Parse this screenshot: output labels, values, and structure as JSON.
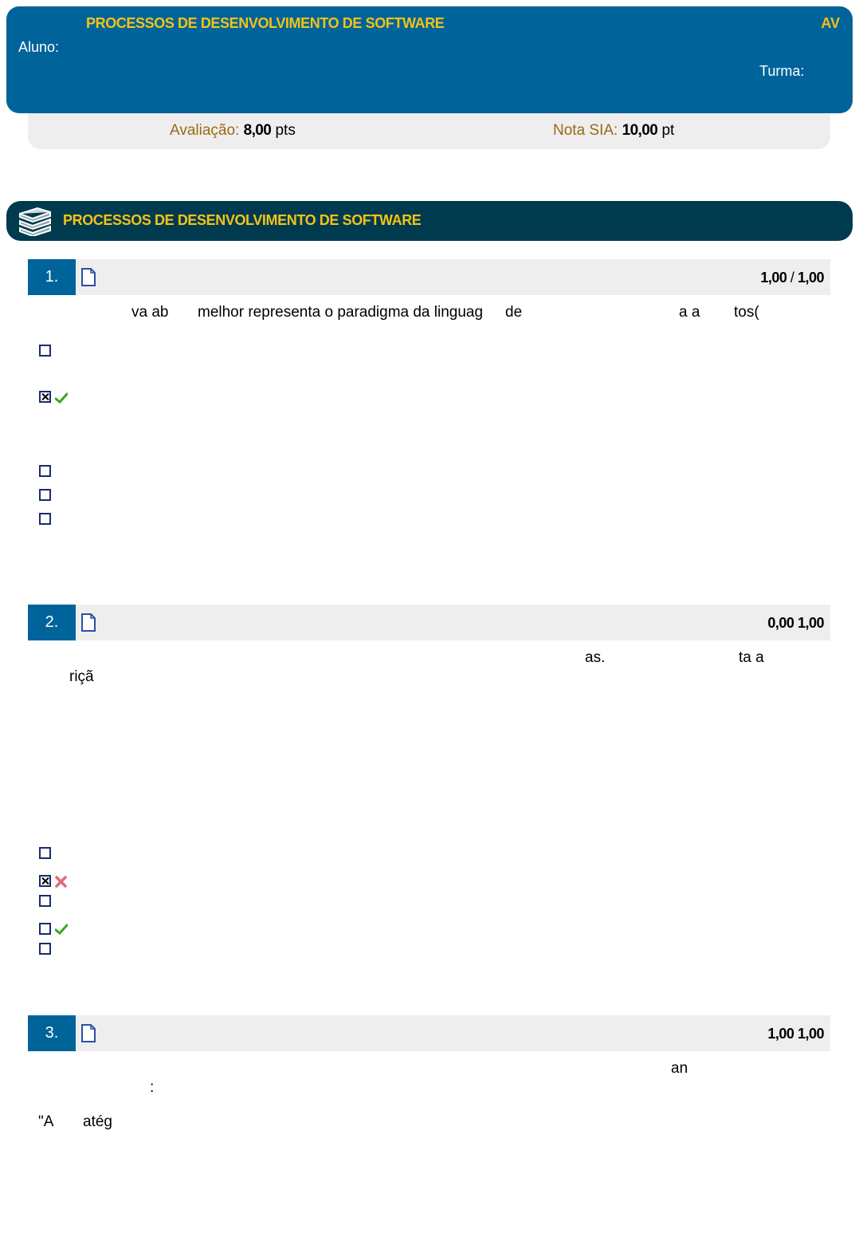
{
  "header": {
    "course": "PROCESSOS DE DESENVOLVIMENTO DE SOFTWARE",
    "av": "AV",
    "aluno_label": "Aluno:",
    "turma_label": "Turma:"
  },
  "scores": {
    "avaliacao_label": "Avaliação:",
    "avaliacao_value": "8,00",
    "avaliacao_unit": "pts",
    "nota_label": "Nota SIA:",
    "nota_value": "10,00",
    "nota_unit": "pt"
  },
  "section": {
    "title": "PROCESSOS DE DESENVOLVIMENTO DE SOFTWARE",
    "icon": "books-icon"
  },
  "questions": [
    {
      "number": "1.",
      "score": "1,00",
      "sep": "/",
      "max": "1,00",
      "fragments": [
        "va ab",
        "melhor representa o paradigma da linguag",
        "de",
        "a a",
        "tos("
      ],
      "options": [
        {
          "checked": false,
          "mark": ""
        },
        {
          "checked": true,
          "mark": "correct-icon"
        },
        {
          "checked": false,
          "mark": ""
        },
        {
          "checked": false,
          "mark": ""
        },
        {
          "checked": false,
          "mark": ""
        }
      ]
    },
    {
      "number": "2.",
      "score": "0,00",
      "sep": "",
      "max": "1,00",
      "fragments": [
        "as.",
        "ta a",
        "riçã"
      ],
      "options": [
        {
          "checked": false,
          "mark": ""
        },
        {
          "checked": true,
          "mark": "wrong-icon"
        },
        {
          "checked": false,
          "mark": ""
        },
        {
          "checked": false,
          "mark": "correct-icon"
        },
        {
          "checked": false,
          "mark": ""
        }
      ]
    },
    {
      "number": "3.",
      "score": "1,00",
      "sep": "",
      "max": "1,00",
      "fragments": [
        "an",
        ":",
        "\"A",
        "atég"
      ]
    }
  ],
  "colors": {
    "header_blue": "#00639a",
    "section_dark": "#003a4e",
    "title_yellow": "#f2c318",
    "label_brown": "#9a6b12"
  }
}
